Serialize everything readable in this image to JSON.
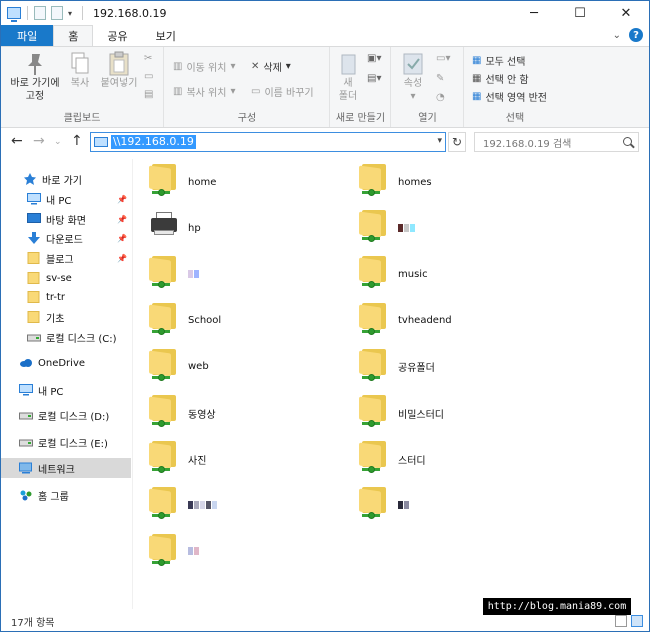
{
  "window": {
    "title": "192.168.0.19",
    "controls": {
      "minimize": "─",
      "maximize": "☐",
      "close": "✕"
    }
  },
  "ribbon_tabs": [
    {
      "label": "파일"
    },
    {
      "label": "홈"
    },
    {
      "label": "공유"
    },
    {
      "label": "보기"
    }
  ],
  "ribbon": {
    "clipboard": {
      "group_label": "클립보드",
      "pin_label_1": "바로 가기에",
      "pin_label_2": "고정",
      "copy_label": "복사",
      "paste_label": "붙여넣기"
    },
    "organize": {
      "group_label": "구성",
      "move_to": "이동 위치",
      "copy_to": "복사 위치",
      "delete": "삭제",
      "rename": "이름 바꾸기"
    },
    "new": {
      "group_label": "새로 만들기",
      "new_folder_1": "새",
      "new_folder_2": "폴더"
    },
    "open": {
      "group_label": "열기",
      "properties": "속성"
    },
    "select": {
      "group_label": "선택",
      "select_all": "모두 선택",
      "select_none": "선택 안 함",
      "invert": "선택 영역 반전"
    }
  },
  "address": {
    "path": "\\\\192.168.0.19",
    "search_placeholder": "192.168.0.19 검색"
  },
  "nav_pane": {
    "items": [
      {
        "label": "바로 가기",
        "icon": "star-icon",
        "pinned": false
      },
      {
        "label": "내 PC",
        "icon": "pc-icon",
        "pinned": true
      },
      {
        "label": "바탕 화면",
        "icon": "desktop-icon",
        "pinned": true
      },
      {
        "label": "다운로드",
        "icon": "download-icon",
        "pinned": true
      },
      {
        "label": "블로그",
        "icon": "folder-icon",
        "pinned": true
      },
      {
        "label": "sv-se",
        "icon": "folder-icon",
        "pinned": false
      },
      {
        "label": "tr-tr",
        "icon": "folder-icon",
        "pinned": false
      },
      {
        "label": "기초",
        "icon": "folder-icon",
        "pinned": false
      },
      {
        "label": "로컬 디스크 (C:)",
        "icon": "drive-icon",
        "pinned": false
      },
      {
        "label": "OneDrive",
        "icon": "cloud-icon",
        "pinned": false
      },
      {
        "label": "내 PC",
        "icon": "pc-icon",
        "pinned": false
      },
      {
        "label": "로컬 디스크 (D:)",
        "icon": "drive-icon",
        "pinned": false
      },
      {
        "label": "로컬 디스크 (E:)",
        "icon": "drive-icon",
        "pinned": false
      },
      {
        "label": "네트워크",
        "icon": "network-icon",
        "pinned": false
      },
      {
        "label": "홈 그룹",
        "icon": "homegroup-icon",
        "pinned": false
      }
    ]
  },
  "shares": [
    {
      "name": "home",
      "type": "share"
    },
    {
      "name": "homes",
      "type": "share"
    },
    {
      "name": "hp",
      "type": "printer"
    },
    {
      "name": "",
      "type": "share",
      "redacted": [
        "#5a2a2a",
        "#c8c8c8",
        "#8fe8ff"
      ]
    },
    {
      "name": "",
      "type": "share",
      "redacted": [
        "#d9c9e6",
        "#9fb4ff"
      ]
    },
    {
      "name": "music",
      "type": "share"
    },
    {
      "name": "School",
      "type": "share"
    },
    {
      "name": "tvheadend",
      "type": "share"
    },
    {
      "name": "web",
      "type": "share"
    },
    {
      "name": "공유폴더",
      "type": "share"
    },
    {
      "name": "동영상",
      "type": "share"
    },
    {
      "name": "비밀스터디",
      "type": "share"
    },
    {
      "name": "사진",
      "type": "share"
    },
    {
      "name": "스터디",
      "type": "share"
    },
    {
      "name": "",
      "type": "share",
      "redacted": [
        "#3a3a55",
        "#aab",
        "#d6d6e8",
        "#556",
        "#c9d6f0"
      ]
    },
    {
      "name": "",
      "type": "share",
      "redacted": [
        "#2a2a3a",
        "#8a8aa0"
      ]
    },
    {
      "name": "",
      "type": "share",
      "redacted": [
        "#b7bce0",
        "#e0b7c8"
      ]
    }
  ],
  "status": {
    "count": "17개 항목",
    "watermark": "http://blog.mania89.com"
  },
  "colors": {
    "accent": "#1979ca",
    "selection": "#3399ff",
    "folder": "#f9d977"
  }
}
